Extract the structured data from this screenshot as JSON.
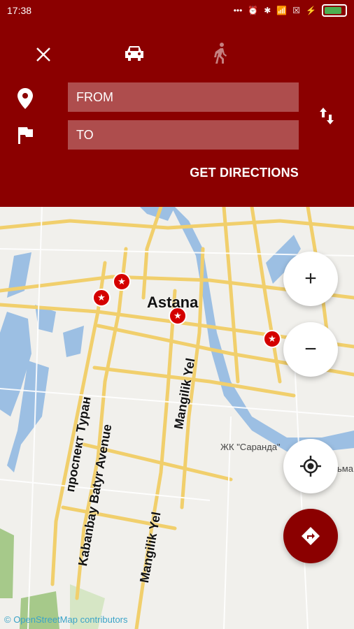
{
  "status": {
    "time": "17:38"
  },
  "header": {
    "from_placeholder": "FROM",
    "to_placeholder": "TO",
    "get_directions": "GET DIRECTIONS"
  },
  "map": {
    "city": "Astana",
    "roads": {
      "r1": "проспект Туран",
      "r2": "Kabanbay Batyr Avenue",
      "r3": "Mangilik Yel",
      "r4": "Mangilik Yel"
    },
    "district": "ЖК \"Саранда\"",
    "district_partial": "ьма",
    "attribution": "© OpenStreetMap contributors"
  },
  "controls": {
    "zoom_in": "+",
    "zoom_out": "−"
  }
}
